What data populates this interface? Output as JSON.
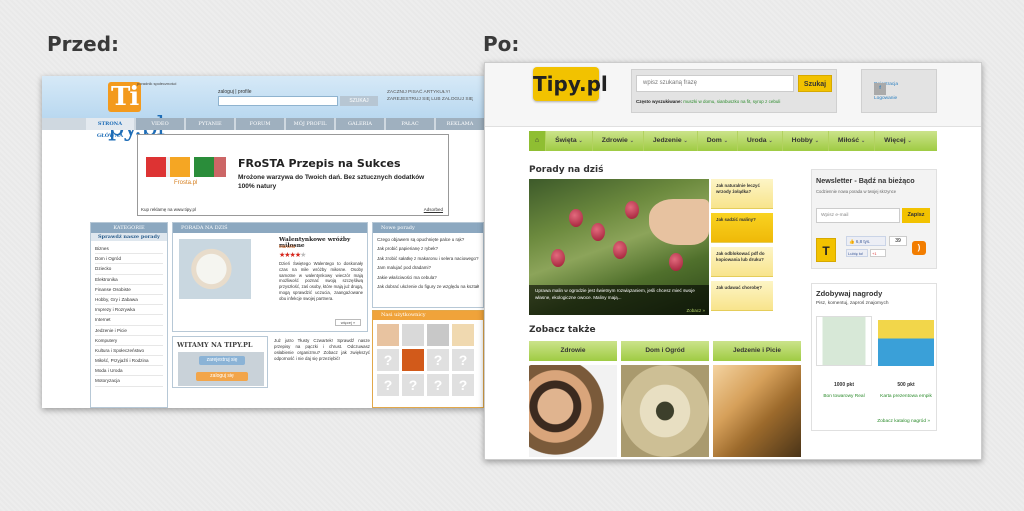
{
  "labels": {
    "before": "Przed:",
    "after": "Po:"
  },
  "before": {
    "logo": "Tipy.pl",
    "logo_sub": "poradnik społeczności",
    "links": "zaloguj  |  profile",
    "search_button": "SZUKAJ",
    "fb_text": "ZACZNIJ PISAĆ ARTYKUŁY! ZAREJESTRUJ SIĘ LUB ZALOGUJ SIĘ",
    "nav": [
      "STRONA GŁÓWNA",
      "VIDEO",
      "PYTANIE",
      "FORUM",
      "MÓJ PROFIL",
      "GALERIA",
      "PAŁAC",
      "REKLAMA"
    ],
    "ad": {
      "title": "FRoSTA Przepis na Sukces",
      "text": "Mrożone warzywa do Twoich dań. Bez sztucznych dodatków 100% natury",
      "brand": "Frosta.pl",
      "foot": "Kup reklamę na www.tipy.pl",
      "foot_right": "Adsorbed"
    },
    "categories": {
      "header": "KATEGORIE",
      "sub": "Sprawdź nasze porady",
      "items": [
        "Biznes",
        "Dom i Ogród",
        "Dziecko",
        "Elektronika",
        "Finanse Osobiste",
        "Hobby, Gry i Zabawa",
        "Imprezy i Rozrywka",
        "Internet",
        "Jedzenie i Picie",
        "Komputery",
        "Kultura i Społeczeństwo",
        "Miłość, Przyjaźń i Rodzina",
        "Moda i Uroda",
        "Motoryzacja"
      ]
    },
    "tip": {
      "header": "PORADA NA DZIŚ",
      "title": "Walentynkowe wróżby miłosne",
      "author": "Marcela",
      "stars": "★★★★",
      "star_off": "★",
      "text": "Dzień Świętego Walentego to doskonały czas na miłe wróżby miłosne. Osoby samotne w walentynkowy wieczór mają możliwość poznać swoją szczęśliwą przyszłość, zaś osoby, które mają już drugą, mogą sprawdzić uczucia, zaangażowane obu infekcje swojej partnera.",
      "more": "więcej »"
    },
    "welcome": {
      "header": "WITAMY NA TIPY.PL",
      "register": "zarejestruj się",
      "login": "zaloguj się",
      "text": "Już jutro Tłusty Czwartek! Sprawdź nasze przepisy na pączki i chrust. Odczuwasz osłabienie organizmu? Zobacz jak zwiększyć odporność i nie daj się przeziębić!"
    },
    "new_tips": {
      "header": "Nowe porady",
      "items": [
        "Czego objawem są opuchnięte palce u rąk?",
        "Jak probić papierianę z rybek?",
        "Jak zrobić sałatkę z makaronu i selera naciowego?",
        "Jam malujać pod dradami?",
        "Jakie właściwości ma cebula?",
        "Jak dobrać ułożenie do figury ze względu na kształt biustu?"
      ]
    },
    "users": {
      "header": "Nasi użytkownicy"
    }
  },
  "after": {
    "logo": "Tipy.pl",
    "search_placeholder": "wpisz szukaną frazę",
    "search_button": "Szukaj",
    "often_label": "Często wyszukiwane:",
    "often_items": "muszki w domu, sianbuszko na fit, syrop z cebuli",
    "register": "Rejestracja",
    "login": "Logowanie",
    "nav": [
      "Święta",
      "Zdrowie",
      "Jedzenie",
      "Dom",
      "Uroda",
      "Hobby",
      "Miłość",
      "Więcej"
    ],
    "tips_header": "Porady na dziś",
    "hero_caption": "Uprawa malin w ogrodzie jest świetnym rozwiązaniem, jeśli chcesz mieć swoje własne, ekologiczne owoce. Maliny mają...",
    "hero_more": "Zobacz »",
    "tips": [
      "Jak naturalnie leczyć wrzody żołądka?",
      "Jak sadzić maliny?",
      "Jak odblokować pdf do kopiowania lub druku?",
      "Jak udawać chorobę?"
    ],
    "see_also": "Zobacz także",
    "categories": [
      "Zdrowie",
      "Dom i Ogród",
      "Jedzenie i Picie"
    ],
    "newsletter": {
      "title": "Newsletter - Bądź na bieżąco",
      "sub": "Codziennie nowa porada w twojej skrzynce",
      "placeholder": "Wpisz e-mail",
      "button": "Zapisz",
      "like": "6,8 tys.",
      "count": "39",
      "like_btn": "Lubię to!",
      "gplus": "+1"
    },
    "rewards": {
      "title": "Zdobywaj nagrody",
      "sub": "Pisz, komentuj, zaproś znajomych",
      "p1_pts": "1000 pkt",
      "p1_name": "Bon towarowy Real",
      "p2_pts": "500 pkt",
      "p2_name": "Karta prezentowa empik",
      "catalog": "Zobacz katalog nagród »"
    }
  }
}
